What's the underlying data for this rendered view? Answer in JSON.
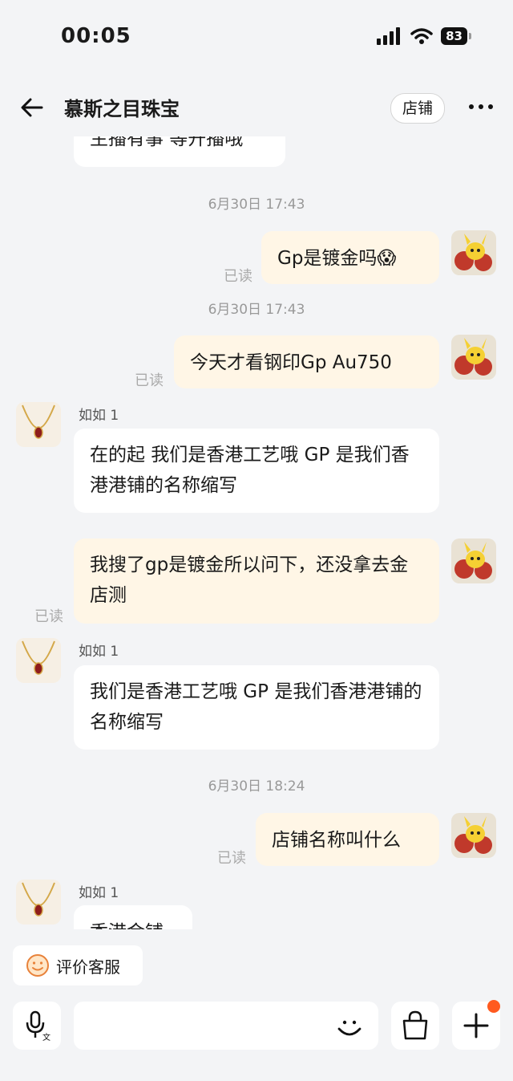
{
  "status_bar": {
    "time": "00:05",
    "battery": "83"
  },
  "header": {
    "title": "慕斯之目珠宝",
    "store_button": "店铺"
  },
  "chat": {
    "cut_message": "主播有事 等开播哦",
    "timestamps": [
      "6月30日 17:43",
      "6月30日 17:43",
      "6月30日 18:24"
    ],
    "read_label": "已读",
    "agent_name": "如如 1",
    "messages": [
      {
        "from": "me",
        "text": "Gp是镀金吗😱"
      },
      {
        "from": "me",
        "text": "今天才看钢印Gp Au750"
      },
      {
        "from": "agent",
        "text": "在的起 我们是香港工艺哦  GP 是我们香港港铺的名称缩写"
      },
      {
        "from": "me",
        "text": "我搜了gp是镀金所以问下，还没拿去金店测"
      },
      {
        "from": "agent",
        "text": "我们是香港工艺哦  GP 是我们香港港铺的名称缩写"
      },
      {
        "from": "me",
        "text": "店铺名称叫什么"
      },
      {
        "from": "agent",
        "text": "香港金铺"
      }
    ]
  },
  "footer": {
    "rate_button": "评价客服",
    "input_placeholder": ""
  },
  "colors": {
    "accent": "#ff5a1f",
    "my_bubble": "#fff6e6",
    "background": "#f3f4f6"
  }
}
